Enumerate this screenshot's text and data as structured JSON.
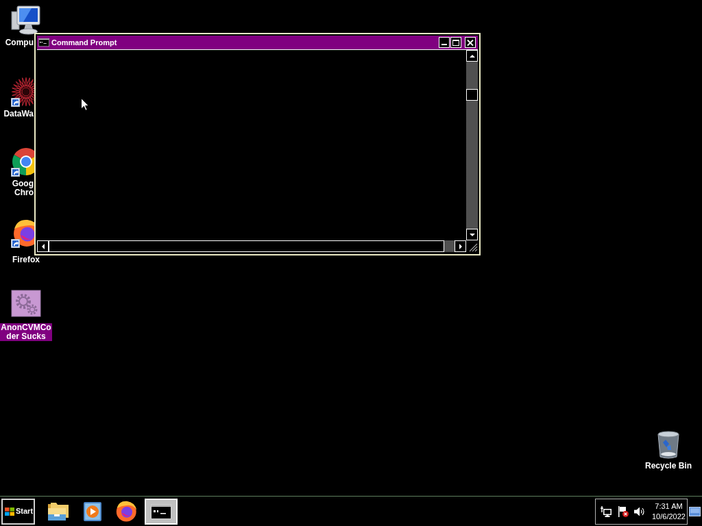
{
  "desktop": {
    "icons": [
      {
        "kind": "computer",
        "label": "Compu",
        "selected": false
      },
      {
        "kind": "star-shortcut",
        "label": "DataWa",
        "selected": false
      },
      {
        "kind": "chrome-shortcut",
        "label": "Goog Chro",
        "selected": false
      },
      {
        "kind": "firefox-shortcut",
        "label": "Firefox",
        "selected": false
      },
      {
        "kind": "settings-file",
        "label": "AnonCVMCoder Sucks",
        "selected": true
      },
      {
        "kind": "recycle-bin",
        "label": "Recycle Bin",
        "selected": false
      }
    ]
  },
  "window": {
    "title": "Command Prompt"
  },
  "taskbar": {
    "start_label": "Start",
    "apps": [
      {
        "kind": "file-explorer",
        "selected": false
      },
      {
        "kind": "media-player",
        "selected": false
      },
      {
        "kind": "firefox",
        "selected": false
      },
      {
        "kind": "command-prompt",
        "selected": true
      }
    ],
    "tray": {
      "icons": [
        {
          "kind": "network"
        },
        {
          "kind": "alert-flag"
        },
        {
          "kind": "volume"
        }
      ],
      "time": "7:31 AM",
      "date": "10/6/2022"
    }
  }
}
